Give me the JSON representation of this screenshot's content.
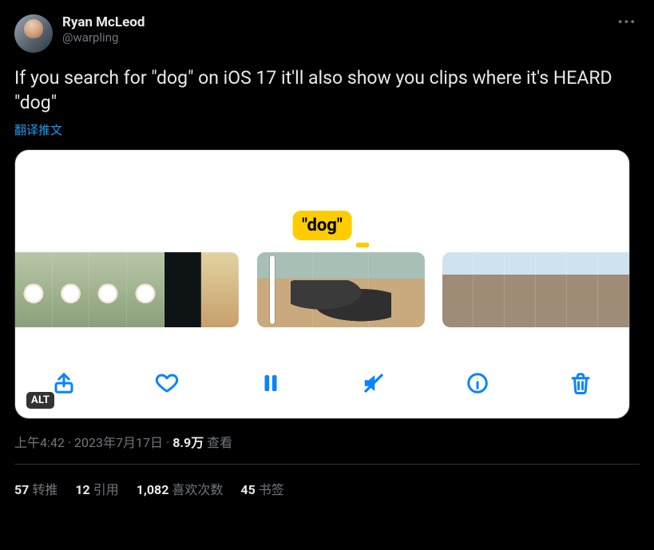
{
  "author": {
    "display_name": "Ryan McLeod",
    "handle": "@warpling"
  },
  "more_icon": "•••",
  "tweet_text": "If you search for \"dog\" on iOS 17 it'll also show you clips where it's HEARD \"dog\"",
  "translate_label": "翻译推文",
  "media": {
    "tooltip": "\"dog\"",
    "alt_badge": "ALT",
    "toolbar_icons": [
      "share",
      "heart",
      "pause",
      "mute",
      "info",
      "trash"
    ]
  },
  "meta": {
    "time": "上午4:42",
    "date": "2023年7月17日",
    "views_count": "8.9万",
    "views_label": "查看"
  },
  "engagement": {
    "retweets": {
      "count": "57",
      "label": "转推"
    },
    "quotes": {
      "count": "12",
      "label": "引用"
    },
    "likes": {
      "count": "1,082",
      "label": "喜欢次数"
    },
    "bookmarks": {
      "count": "45",
      "label": "书签"
    }
  }
}
